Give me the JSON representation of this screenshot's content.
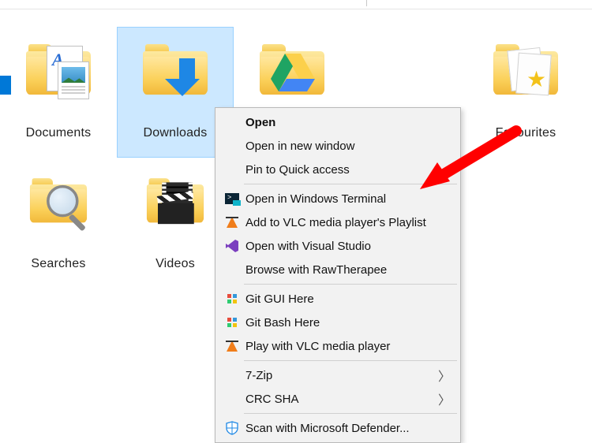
{
  "items": [
    {
      "label": "Documents",
      "name": "folder-documents"
    },
    {
      "label": "Downloads",
      "name": "folder-downloads",
      "selected": true
    },
    {
      "label": "Google Drive",
      "name": "folder-google-drive"
    },
    {
      "label": "",
      "name": "folder-onedrive"
    },
    {
      "label": "Favourites",
      "name": "folder-favourites"
    },
    {
      "label": "Searches",
      "name": "folder-searches"
    },
    {
      "label": "Videos",
      "name": "folder-videos"
    }
  ],
  "menu": {
    "items": [
      {
        "label": "Open",
        "bold": true
      },
      {
        "label": "Open in new window"
      },
      {
        "label": "Pin to Quick access"
      },
      {
        "label": "Open in Windows Terminal",
        "icon": "terminal-icon"
      },
      {
        "label": "Add to VLC media player's Playlist",
        "icon": "cone-icon"
      },
      {
        "label": "Open with Visual Studio",
        "icon": "visual-studio-icon"
      },
      {
        "label": "Browse with RawTherapee"
      },
      {
        "label": "Git GUI Here",
        "icon": "git-icon"
      },
      {
        "label": "Git Bash Here",
        "icon": "git-icon"
      },
      {
        "label": "Play with VLC media player",
        "icon": "cone-icon"
      },
      {
        "label": "7-Zip",
        "submenu": true
      },
      {
        "label": "CRC SHA",
        "submenu": true
      },
      {
        "label": "Scan with Microsoft Defender...",
        "icon": "shield-icon"
      }
    ],
    "separators_after": [
      2,
      6,
      9,
      11
    ]
  },
  "annotation": {
    "arrow_target": "Open in Windows Terminal"
  }
}
